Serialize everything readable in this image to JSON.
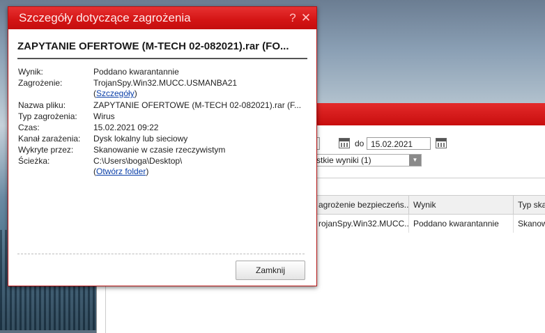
{
  "dialog": {
    "title": "Szczegóły dotyczące zagrożenia",
    "help_glyph": "?",
    "close_glyph": "✕",
    "heading": "ZAPYTANIE OFERTOWE (M-TECH 02-082021).rar (FO...",
    "fields": {
      "result_label": "Wynik:",
      "result_value": "Poddano kwarantannie",
      "threat_label": "Zagrożenie:",
      "threat_value": "TrojanSpy.Win32.MUCC.USMANBA21",
      "details_link": "Szczegóły",
      "filename_label": "Nazwa pliku:",
      "filename_value": "ZAPYTANIE OFERTOWE (M-TECH 02-082021).rar (F...",
      "type_label": "Typ zagrożenia:",
      "type_value": "Wirus",
      "time_label": "Czas:",
      "time_value": "15.02.2021 09:22",
      "channel_label": "Kanał zarażenia:",
      "channel_value": "Dysk lokalny lub sieciowy",
      "detected_label": "Wykryte przez:",
      "detected_value": "Skanowanie w czasie rzeczywistym",
      "path_label": "Ścieżka:",
      "path_value": "C:\\Users\\boga\\Desktop\\",
      "open_folder_link": "Otwórz folder"
    },
    "close_button": "Zamknij"
  },
  "background_window": {
    "date_from_fragment": "1",
    "to_label": "do",
    "date_to": "15.02.2021",
    "filter_select": "stkie wyniki (1)",
    "table": {
      "headers": [
        "agrożenie bezpieczeńs...",
        "Wynik",
        "Typ ska"
      ],
      "rows": [
        [
          "rojanSpy.Win32.MUCC...",
          "Poddano kwarantannie",
          "Skanow"
        ]
      ]
    }
  },
  "colors": {
    "title_bar": "#d31414",
    "link": "#0a3fa8"
  }
}
